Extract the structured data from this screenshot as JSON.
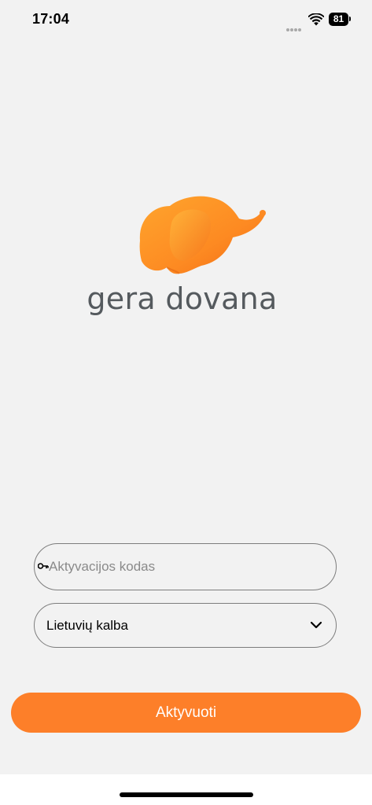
{
  "status_bar": {
    "time": "17:04",
    "battery": "81",
    "signal_icon": "cellular-dots-icon",
    "wifi_icon": "wifi-icon"
  },
  "brand": {
    "name": "gera dovana",
    "logo_icon": "elephant-logo-icon",
    "logo_color": "#fd7f29",
    "text_color": "#555a5e"
  },
  "form": {
    "code_field": {
      "placeholder": "Aktyvacijos kodas",
      "value": "",
      "icon": "key-icon"
    },
    "language_select": {
      "value": "Lietuvių kalba",
      "icon": "chevron-down-icon"
    },
    "activate_button": {
      "label": "Aktyvuoti",
      "color": "#fd7f29"
    }
  },
  "colors": {
    "background": "#f2f2f2",
    "accent": "#fd7f29"
  }
}
